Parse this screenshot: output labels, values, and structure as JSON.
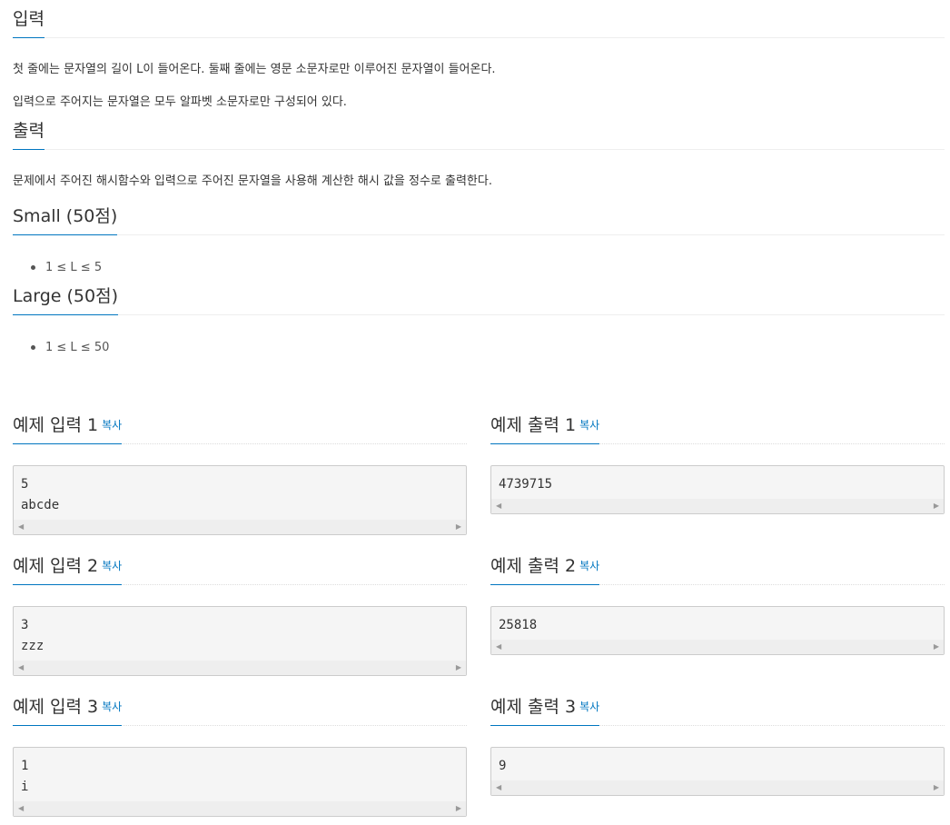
{
  "input_section": {
    "title": "입력",
    "line1": "첫 줄에는 문자열의 길이 L이 들어온다. 둘째 줄에는 영문 소문자로만 이루어진 문자열이 들어온다.",
    "line2": "입력으로 주어지는 문자열은 모두 알파벳 소문자로만 구성되어 있다."
  },
  "output_section": {
    "title": "출력",
    "line1": "문제에서 주어진 해시함수와 입력으로 주어진 문자열을 사용해 계산한 해시 값을 정수로 출력한다."
  },
  "small_section": {
    "title": "Small (50점)",
    "items": [
      "1 ≤ L ≤ 5"
    ]
  },
  "large_section": {
    "title": "Large (50점)",
    "items": [
      "1 ≤ L ≤ 50"
    ]
  },
  "copy_label": "복사",
  "samples": [
    {
      "input_title": "예제 입력 1",
      "input": "5\nabcde",
      "output_title": "예제 출력 1",
      "output": "4739715"
    },
    {
      "input_title": "예제 입력 2",
      "input": "3\nzzz",
      "output_title": "예제 출력 2",
      "output": "25818"
    },
    {
      "input_title": "예제 입력 3",
      "input": "1\ni",
      "output_title": "예제 출력 3",
      "output": "9"
    }
  ]
}
